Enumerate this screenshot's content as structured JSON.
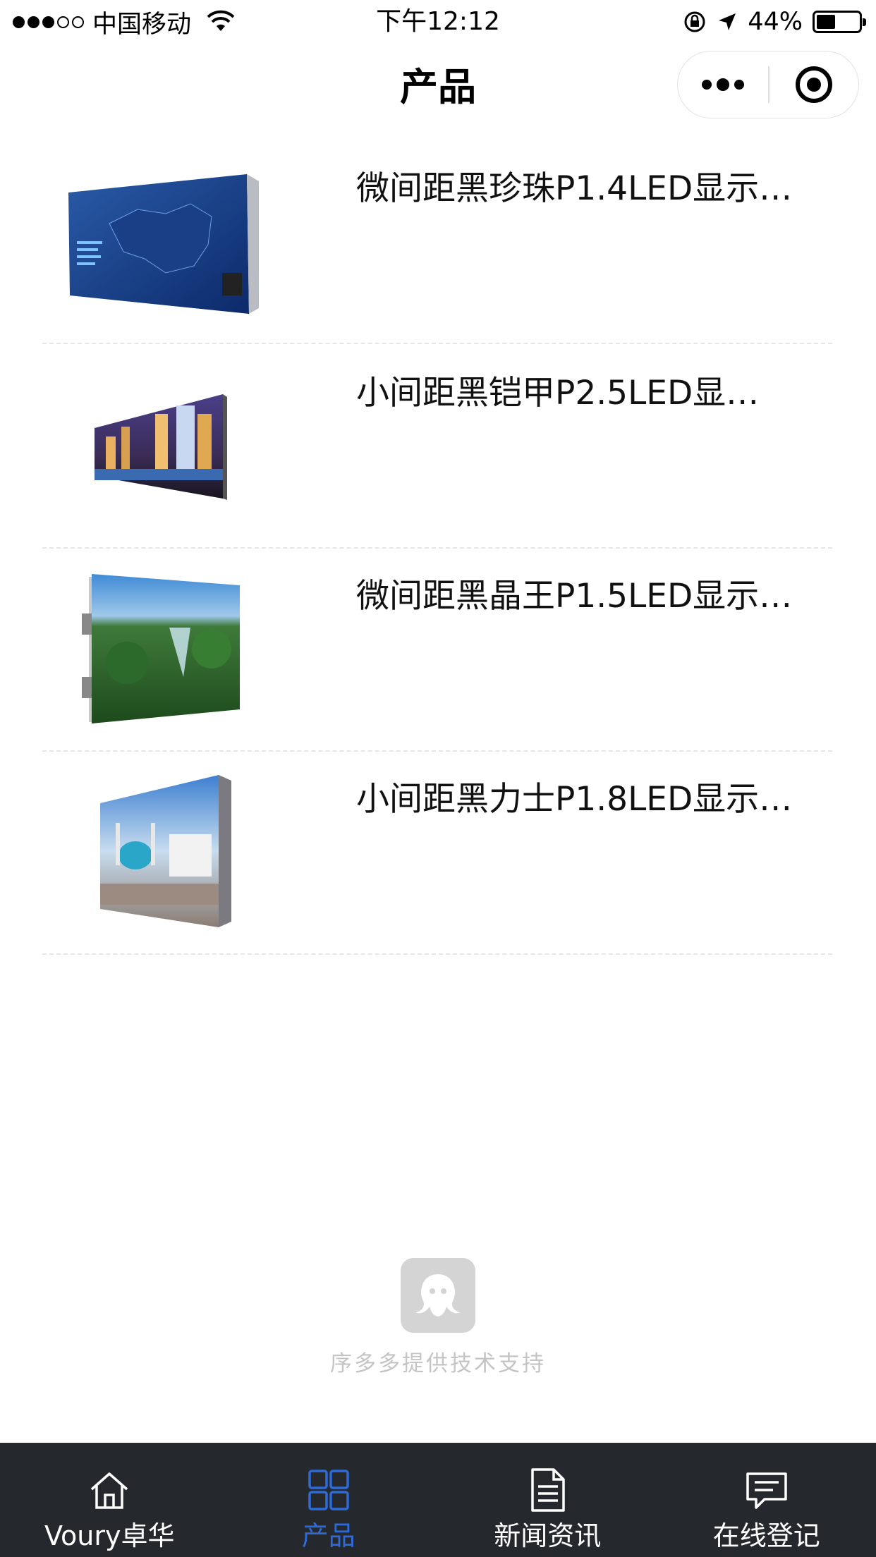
{
  "status_bar": {
    "carrier": "中国移动",
    "time": "下午12:12",
    "battery": "44%"
  },
  "nav": {
    "title": "产品"
  },
  "products": [
    {
      "name": "微间距黑珍珠P1.4LED显示…"
    },
    {
      "name": "小间距黑铠甲P2.5LED显…"
    },
    {
      "name": "微间距黑晶王P1.5LED显示…"
    },
    {
      "name": "小间距黑力士P1.8LED显示…"
    }
  ],
  "support": {
    "text": "序多多提供技术支持"
  },
  "tabs": [
    {
      "label": "Voury卓华",
      "icon": "home-icon",
      "active": false
    },
    {
      "label": "产品",
      "icon": "grid-icon",
      "active": true
    },
    {
      "label": "新闻资讯",
      "icon": "document-icon",
      "active": false
    },
    {
      "label": "在线登记",
      "icon": "chat-icon",
      "active": false
    }
  ],
  "colors": {
    "tab_bar_bg": "#25282c",
    "tab_active": "#2e6bd8",
    "tab_inactive": "#ffffff",
    "support_text": "#c4c4c4"
  }
}
